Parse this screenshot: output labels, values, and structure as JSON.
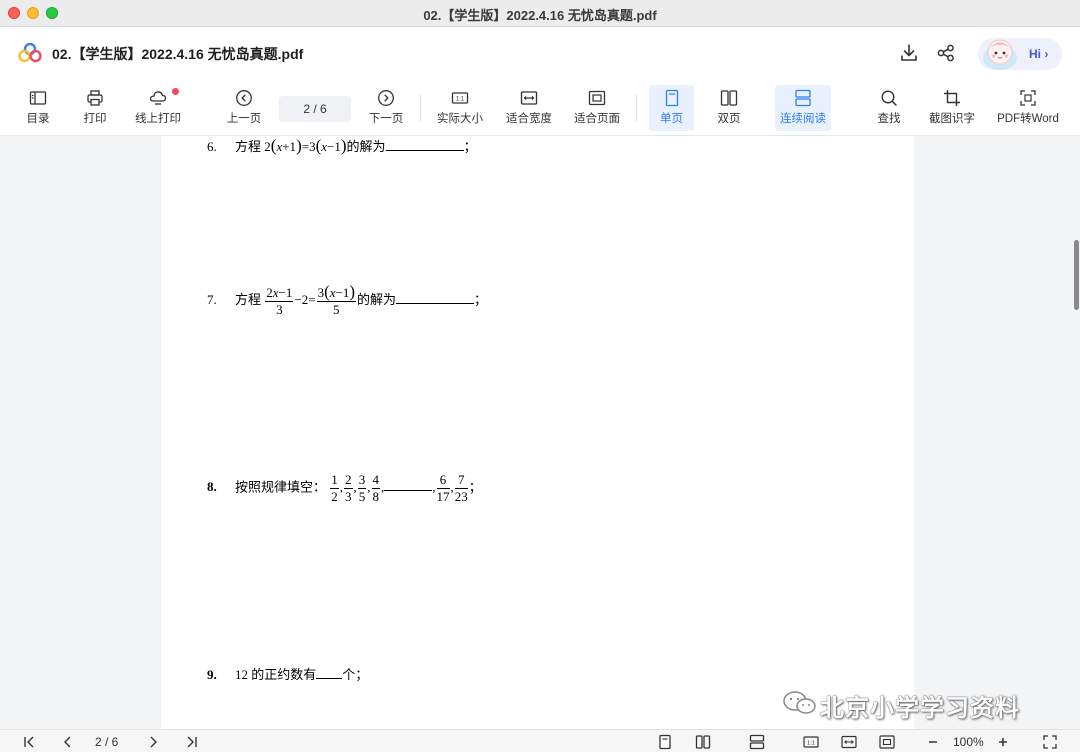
{
  "window": {
    "title": "02.【学生版】2022.4.16 无忧岛真题.pdf"
  },
  "appbar": {
    "doc_title": "02.【学生版】2022.4.16 无忧岛真题.pdf",
    "hi_label": "Hi ›"
  },
  "toolbar": {
    "toc": "目录",
    "print": "打印",
    "online_print": "线上打印",
    "prev_page": "上一页",
    "page_indicator": "2  /  6",
    "next_page": "下一页",
    "actual_size": "实际大小",
    "fit_width": "适合宽度",
    "fit_page": "适合页面",
    "single_page": "单页",
    "double_page": "双页",
    "continuous": "连续阅读",
    "find": "查找",
    "ocr": "截图识字",
    "pdf_to_word": "PDF转Word"
  },
  "document": {
    "q6": {
      "num": "6.",
      "prefix": "方程",
      "suffix": "的解为",
      "end": "；"
    },
    "q7": {
      "num": "7.",
      "prefix": "方程",
      "suffix": "的解为",
      "end": "；"
    },
    "q8": {
      "num": "8.",
      "prefix": "按照规律填空：",
      "end": "；"
    },
    "q9": {
      "num": "9.",
      "text_a": "12 的正约数有",
      "text_b": "个；"
    }
  },
  "watermark": "北京小学学习资料",
  "bottombar": {
    "page_indicator": "2  /  6",
    "zoom": "100%"
  },
  "colors": {
    "accent": "#2f7df6",
    "active_bg": "#e9f1ff",
    "notify_dot": "#f04a5c"
  }
}
